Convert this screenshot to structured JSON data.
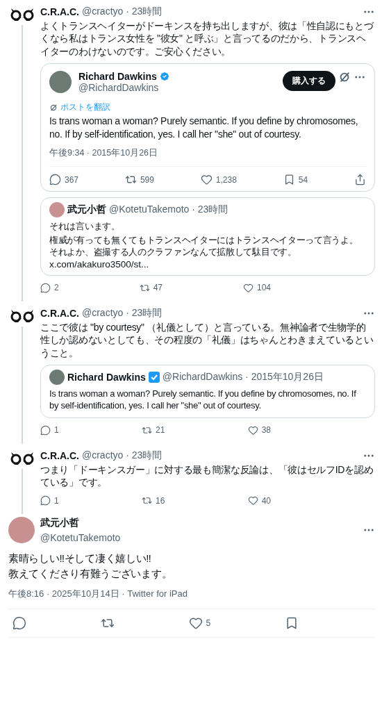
{
  "thread": [
    {
      "author": "C.R.A.C.",
      "handle": "@cractyo · 23時間",
      "text": "よくトランスヘイターがドーキンスを持ち出しますが、彼は「性自認にもとづくなら私はトランス女性を \"彼女\" と呼ぶ」と言ってるのだから、トランスヘイターのわけないのです。ご安心ください。",
      "cards": [
        {
          "kind": "embed",
          "author": "Richard Dawkins",
          "handle": "@RichardDawkins",
          "buy": "購入する",
          "translate": "ポストを翻訳",
          "text": "Is trans woman a woman? Purely semantic. If you define by chromosomes, no. If by self-identification, yes. I call her \"she\" out of courtesy.",
          "timestamp": "午後9:34 · 2015年10月26日",
          "actions": [
            {
              "kind": "reply",
              "count": "367"
            },
            {
              "kind": "repost",
              "count": "599"
            },
            {
              "kind": "like",
              "count": "1,238"
            },
            {
              "kind": "bookmark",
              "count": "54"
            },
            {
              "kind": "share"
            }
          ]
        },
        {
          "kind": "quote",
          "author": "武元小哲",
          "handle": "@KotetuTakemoto · 23時間",
          "lines": [
            "それは言います。",
            "権威が有っても無くてもトランスヘイターにはトランスヘイターって言うよ。それよか、盗撮する人のクラファンなんて拡散して駄目です。"
          ],
          "link": "x.com/akakuro3500/st..."
        }
      ],
      "actions": [
        {
          "kind": "reply",
          "count": "2"
        },
        {
          "kind": "repost",
          "count": "47"
        },
        {
          "kind": "like",
          "count": "104"
        }
      ]
    },
    {
      "author": "C.R.A.C.",
      "handle": "@cractyo · 23時間",
      "text": "ここで彼は \"by courtesy\" （礼儀として）と言っている。無神論者で生物学的性しか認めないとしても、その程度の「礼儀」はちゃんとわきまえているということ。",
      "cards": [
        {
          "kind": "quote",
          "author": "Richard Dawkins",
          "handle": "@RichardDawkins · 2015年10月26日",
          "lines": [
            "Is trans woman a woman? Purely semantic. If you define by chromosomes, no. If by self-identification, yes. I call her \"she\" out of courtesy."
          ]
        }
      ],
      "actions": [
        {
          "kind": "reply",
          "count": "1"
        },
        {
          "kind": "repost",
          "count": "21"
        },
        {
          "kind": "like",
          "count": "38"
        }
      ]
    },
    {
      "author": "C.R.A.C.",
      "handle": "@cractyo · 23時間",
      "text": "つまり「ドーキンスガー」に対する最も簡潔な反論は、「彼はセルフIDを認めている」です。",
      "actions": [
        {
          "kind": "reply",
          "count": "1"
        },
        {
          "kind": "repost",
          "count": "16"
        },
        {
          "kind": "like",
          "count": "40"
        }
      ]
    }
  ],
  "main": {
    "author": "武元小哲",
    "handle": "@KotetuTakemoto",
    "lines": [
      "素晴らしい‼そして凄く嬉しい‼",
      "教えてくださり有難うございます。"
    ],
    "meta": "午後8:16 · 2025年10月14日 · Twitter for iPad",
    "actions": [
      {
        "kind": "reply"
      },
      {
        "kind": "repost"
      },
      {
        "kind": "like",
        "count": "5"
      },
      {
        "kind": "bookmark"
      }
    ]
  }
}
